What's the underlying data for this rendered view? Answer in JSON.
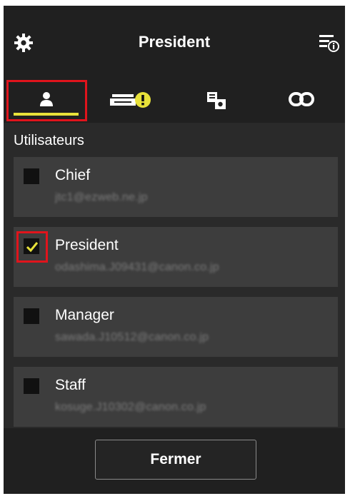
{
  "header": {
    "title": "President",
    "settings_icon": "gear-icon",
    "info_menu_icon": "list-info-icon"
  },
  "tabs": [
    {
      "id": "users",
      "icon": "person-icon",
      "active": true
    },
    {
      "id": "printer",
      "icon": "printer-warning-icon",
      "active": false
    },
    {
      "id": "functions",
      "icon": "apps-icon",
      "active": false
    },
    {
      "id": "links",
      "icon": "link-icon",
      "active": false
    }
  ],
  "section": {
    "label": "Utilisateurs"
  },
  "users": [
    {
      "name": "Chief",
      "email": "jtc1@ezweb.ne.jp",
      "checked": false
    },
    {
      "name": "President",
      "email": "odashima.J09431@canon.co.jp",
      "checked": true
    },
    {
      "name": "Manager",
      "email": "sawada.J10512@canon.co.jp",
      "checked": false
    },
    {
      "name": "Staff",
      "email": "kosuge.J10302@canon.co.jp",
      "checked": false
    }
  ],
  "footer": {
    "close_label": "Fermer"
  },
  "colors": {
    "accent": "#e8e23a",
    "highlight_box": "#e0141c",
    "background": "#2a2a2a",
    "row": "#3d3d3d"
  }
}
